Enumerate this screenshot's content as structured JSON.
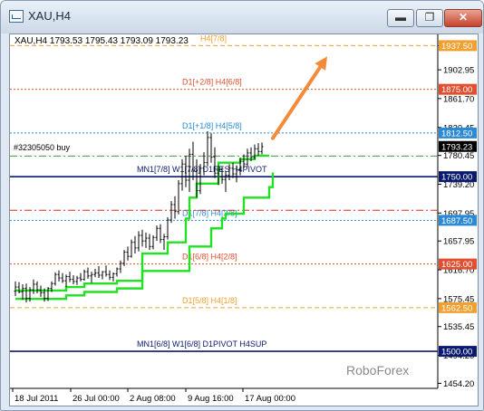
{
  "window": {
    "title": "XAU,H4",
    "minimize_glyph": "▬",
    "restore_glyph": "❐",
    "close_glyph": "✕"
  },
  "chart_data": {
    "type": "candlestick",
    "title": "XAU,H4",
    "ohlc_header": "XAU,H4  1793.53 1795.43 1793.09 1793.23",
    "watermark": "RoboForex",
    "trade_label": "#32305050 buy",
    "price_axis": {
      "ticks": [
        1937.35,
        1902.95,
        1861.7,
        1820.45,
        1780.45,
        1739.2,
        1697.95,
        1657.95,
        1616.7,
        1575.45,
        1535.45,
        1494.2,
        1454.2
      ],
      "ylim": [
        1447,
        1946
      ]
    },
    "time_axis": {
      "labels": [
        "18 Jul 2011",
        "26 Jul 00:00",
        "2 Aug 08:00",
        "9 Aug 16:00",
        "17 Aug 00:00"
      ]
    },
    "levels": [
      {
        "price": 1937.5,
        "label": "H4[7/8]",
        "color": "#f0a030",
        "style": "dash",
        "badge": "1937.50"
      },
      {
        "price": 1875.0,
        "label": "D1[+2/8] H4[6/8]",
        "color": "#e05030",
        "style": "dot",
        "badge": "1875.00"
      },
      {
        "price": 1812.5,
        "label": "D1[+1/8] H4[5/8]",
        "color": "#2a8ad6",
        "style": "dot",
        "badge": "1812.50"
      },
      {
        "price": 1750.0,
        "label": "MN1[7/8] W1[7/8] D1RES H4PIVOT",
        "color": "#0a1a6e",
        "style": "solid",
        "badge": "1750.00"
      },
      {
        "price": 1687.5,
        "label": "D1[7/8] H4[3/8]",
        "color": "#2a8ad6",
        "style": "dot",
        "badge": "1687.50"
      },
      {
        "price": 1625.0,
        "label": "D1[6/8] H4[2/8]",
        "color": "#e05030",
        "style": "dot",
        "badge": "1625.00"
      },
      {
        "price": 1562.5,
        "label": "D1[5/8] H4[1/8]",
        "color": "#f0a030",
        "style": "dash",
        "badge": "1562.50"
      },
      {
        "price": 1500.0,
        "label": "MN1[6/8] W1[6/8] D1PIVOT H4SUP",
        "color": "#0a1a6e",
        "style": "solid",
        "badge": "1500.00"
      }
    ],
    "current_price": {
      "price": 1793.23,
      "badge": "1793.23"
    },
    "entry_line": {
      "price": 1779.5,
      "color": "#3a9a3a"
    },
    "sell_line": {
      "price": 1702.0,
      "color": "#d03020"
    },
    "candles": [
      {
        "o": 1586,
        "h": 1600,
        "l": 1579,
        "c": 1592
      },
      {
        "o": 1592,
        "h": 1599,
        "l": 1583,
        "c": 1585
      },
      {
        "o": 1585,
        "h": 1596,
        "l": 1574,
        "c": 1590
      },
      {
        "o": 1590,
        "h": 1597,
        "l": 1570,
        "c": 1576
      },
      {
        "o": 1576,
        "h": 1592,
        "l": 1571,
        "c": 1588
      },
      {
        "o": 1588,
        "h": 1603,
        "l": 1582,
        "c": 1596
      },
      {
        "o": 1596,
        "h": 1600,
        "l": 1583,
        "c": 1588
      },
      {
        "o": 1588,
        "h": 1594,
        "l": 1578,
        "c": 1584
      },
      {
        "o": 1584,
        "h": 1590,
        "l": 1571,
        "c": 1576
      },
      {
        "o": 1576,
        "h": 1592,
        "l": 1572,
        "c": 1590
      },
      {
        "o": 1590,
        "h": 1600,
        "l": 1585,
        "c": 1597
      },
      {
        "o": 1597,
        "h": 1613,
        "l": 1594,
        "c": 1610
      },
      {
        "o": 1610,
        "h": 1616,
        "l": 1600,
        "c": 1605
      },
      {
        "o": 1605,
        "h": 1612,
        "l": 1598,
        "c": 1601
      },
      {
        "o": 1601,
        "h": 1610,
        "l": 1592,
        "c": 1607
      },
      {
        "o": 1607,
        "h": 1614,
        "l": 1599,
        "c": 1603
      },
      {
        "o": 1603,
        "h": 1609,
        "l": 1596,
        "c": 1600
      },
      {
        "o": 1600,
        "h": 1608,
        "l": 1595,
        "c": 1605
      },
      {
        "o": 1605,
        "h": 1612,
        "l": 1600,
        "c": 1603
      },
      {
        "o": 1603,
        "h": 1617,
        "l": 1601,
        "c": 1614
      },
      {
        "o": 1614,
        "h": 1620,
        "l": 1604,
        "c": 1608
      },
      {
        "o": 1608,
        "h": 1614,
        "l": 1598,
        "c": 1610
      },
      {
        "o": 1610,
        "h": 1618,
        "l": 1606,
        "c": 1612
      },
      {
        "o": 1612,
        "h": 1622,
        "l": 1605,
        "c": 1609
      },
      {
        "o": 1609,
        "h": 1615,
        "l": 1603,
        "c": 1614
      },
      {
        "o": 1614,
        "h": 1623,
        "l": 1607,
        "c": 1610
      },
      {
        "o": 1610,
        "h": 1616,
        "l": 1602,
        "c": 1606
      },
      {
        "o": 1606,
        "h": 1613,
        "l": 1600,
        "c": 1611
      },
      {
        "o": 1611,
        "h": 1620,
        "l": 1607,
        "c": 1618
      },
      {
        "o": 1618,
        "h": 1630,
        "l": 1612,
        "c": 1626
      },
      {
        "o": 1626,
        "h": 1645,
        "l": 1622,
        "c": 1642
      },
      {
        "o": 1642,
        "h": 1650,
        "l": 1630,
        "c": 1636
      },
      {
        "o": 1636,
        "h": 1660,
        "l": 1634,
        "c": 1656
      },
      {
        "o": 1656,
        "h": 1665,
        "l": 1640,
        "c": 1648
      },
      {
        "o": 1648,
        "h": 1672,
        "l": 1643,
        "c": 1666
      },
      {
        "o": 1666,
        "h": 1674,
        "l": 1650,
        "c": 1658
      },
      {
        "o": 1658,
        "h": 1670,
        "l": 1648,
        "c": 1662
      },
      {
        "o": 1662,
        "h": 1668,
        "l": 1645,
        "c": 1650
      },
      {
        "o": 1650,
        "h": 1666,
        "l": 1646,
        "c": 1663
      },
      {
        "o": 1663,
        "h": 1680,
        "l": 1658,
        "c": 1676
      },
      {
        "o": 1676,
        "h": 1682,
        "l": 1655,
        "c": 1660
      },
      {
        "o": 1660,
        "h": 1668,
        "l": 1645,
        "c": 1664
      },
      {
        "o": 1664,
        "h": 1692,
        "l": 1660,
        "c": 1688
      },
      {
        "o": 1688,
        "h": 1715,
        "l": 1684,
        "c": 1710
      },
      {
        "o": 1710,
        "h": 1722,
        "l": 1690,
        "c": 1700
      },
      {
        "o": 1700,
        "h": 1745,
        "l": 1696,
        "c": 1740
      },
      {
        "o": 1740,
        "h": 1775,
        "l": 1730,
        "c": 1768
      },
      {
        "o": 1768,
        "h": 1780,
        "l": 1735,
        "c": 1745
      },
      {
        "o": 1745,
        "h": 1790,
        "l": 1728,
        "c": 1782
      },
      {
        "o": 1782,
        "h": 1800,
        "l": 1745,
        "c": 1758
      },
      {
        "o": 1758,
        "h": 1775,
        "l": 1720,
        "c": 1730
      },
      {
        "o": 1730,
        "h": 1768,
        "l": 1725,
        "c": 1762
      },
      {
        "o": 1762,
        "h": 1785,
        "l": 1752,
        "c": 1770
      },
      {
        "o": 1770,
        "h": 1815,
        "l": 1765,
        "c": 1806
      },
      {
        "o": 1806,
        "h": 1812,
        "l": 1770,
        "c": 1778
      },
      {
        "o": 1778,
        "h": 1792,
        "l": 1748,
        "c": 1755
      },
      {
        "o": 1755,
        "h": 1766,
        "l": 1738,
        "c": 1760
      },
      {
        "o": 1760,
        "h": 1764,
        "l": 1740,
        "c": 1746
      },
      {
        "o": 1746,
        "h": 1758,
        "l": 1728,
        "c": 1752
      },
      {
        "o": 1752,
        "h": 1768,
        "l": 1745,
        "c": 1762
      },
      {
        "o": 1762,
        "h": 1770,
        "l": 1748,
        "c": 1754
      },
      {
        "o": 1754,
        "h": 1766,
        "l": 1742,
        "c": 1760
      },
      {
        "o": 1760,
        "h": 1777,
        "l": 1752,
        "c": 1772
      },
      {
        "o": 1772,
        "h": 1782,
        "l": 1762,
        "c": 1768
      },
      {
        "o": 1768,
        "h": 1790,
        "l": 1764,
        "c": 1784
      },
      {
        "o": 1784,
        "h": 1792,
        "l": 1772,
        "c": 1778
      },
      {
        "o": 1778,
        "h": 1796,
        "l": 1775,
        "c": 1790
      },
      {
        "o": 1790,
        "h": 1798,
        "l": 1780,
        "c": 1786
      },
      {
        "o": 1786,
        "h": 1799,
        "l": 1782,
        "c": 1793
      }
    ],
    "trailing_stop_1": [
      [
        0,
        1575
      ],
      [
        14,
        1575
      ],
      [
        14,
        1580
      ],
      [
        19,
        1580
      ],
      [
        19,
        1585
      ],
      [
        28,
        1585
      ],
      [
        28,
        1590
      ],
      [
        35,
        1590
      ],
      [
        35,
        1615
      ],
      [
        48,
        1615
      ],
      [
        48,
        1650
      ],
      [
        54,
        1650
      ],
      [
        54,
        1676
      ],
      [
        57,
        1676
      ],
      [
        57,
        1690
      ],
      [
        58,
        1690
      ],
      [
        58,
        1697
      ],
      [
        63,
        1697
      ],
      [
        63,
        1720
      ],
      [
        70,
        1720
      ],
      [
        70,
        1735
      ],
      [
        71,
        1735
      ],
      [
        71,
        1756
      ]
    ],
    "trailing_stop_2": [
      [
        0,
        1587
      ],
      [
        14,
        1587
      ],
      [
        14,
        1592
      ],
      [
        19,
        1592
      ],
      [
        19,
        1597
      ],
      [
        28,
        1597
      ],
      [
        28,
        1601
      ],
      [
        35,
        1601
      ],
      [
        35,
        1640
      ],
      [
        42,
        1640
      ],
      [
        42,
        1656
      ],
      [
        47,
        1656
      ],
      [
        47,
        1690
      ],
      [
        48,
        1690
      ],
      [
        48,
        1720
      ],
      [
        50,
        1720
      ],
      [
        50,
        1740
      ],
      [
        56,
        1740
      ],
      [
        56,
        1770
      ],
      [
        62,
        1770
      ],
      [
        62,
        1775
      ],
      [
        66,
        1775
      ],
      [
        66,
        1780
      ],
      [
        70,
        1780
      ]
    ],
    "forecast_arrow": {
      "from": [
        71,
        1805
      ],
      "to": [
        81,
        1922
      ],
      "color": "#f58a3a"
    }
  }
}
